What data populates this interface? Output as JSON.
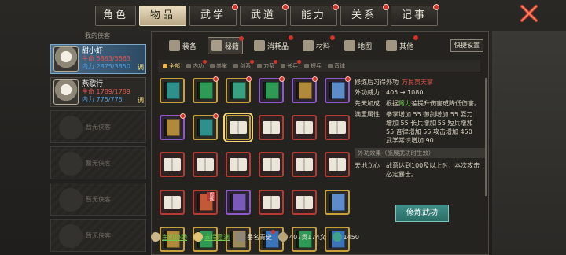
{
  "top_tabs": [
    {
      "label": "角色",
      "active": false,
      "dot": false
    },
    {
      "label": "物品",
      "active": true,
      "dot": false
    },
    {
      "label": "武学",
      "active": false,
      "dot": true
    },
    {
      "label": "武道",
      "active": false,
      "dot": true
    },
    {
      "label": "能力",
      "active": false,
      "dot": true
    },
    {
      "label": "关系",
      "active": false,
      "dot": true
    },
    {
      "label": "记事",
      "active": false,
      "dot": true
    }
  ],
  "roster": {
    "title": "我的侠客",
    "heroes": [
      {
        "name": "甜小虾",
        "hp": "生命 5863/5863",
        "mp": "内力 2875/3850",
        "tag": "调",
        "active": true
      },
      {
        "name": "燕歌行",
        "hp": "生命 1789/1789",
        "mp": "内力 775/775",
        "tag": "调",
        "active": false
      }
    ],
    "empty_label": "暂无侠客",
    "empty_count": 4
  },
  "categories": [
    {
      "label": "装备",
      "active": false,
      "icon": "helmet-icon",
      "dot": false
    },
    {
      "label": "秘籍",
      "active": true,
      "icon": "scroll-icon",
      "dot": true
    },
    {
      "label": "消耗品",
      "active": false,
      "icon": "flask-icon",
      "dot": true
    },
    {
      "label": "材料",
      "active": false,
      "icon": "ore-icon",
      "dot": true
    },
    {
      "label": "地图",
      "active": false,
      "icon": "map-icon",
      "dot": false
    },
    {
      "label": "其他",
      "active": false,
      "icon": "bag-icon",
      "dot": true
    }
  ],
  "quick_settings": "快捷设置",
  "filters": [
    {
      "label": "全部",
      "active": true,
      "dot": false
    },
    {
      "label": "内功",
      "active": false,
      "dot": true
    },
    {
      "label": "拳掌",
      "active": false,
      "dot": false
    },
    {
      "label": "剑系",
      "active": false,
      "dot": true
    },
    {
      "label": "刀系",
      "active": false,
      "dot": true
    },
    {
      "label": "长兵",
      "active": false,
      "dot": true
    },
    {
      "label": "短兵",
      "active": false,
      "dot": false
    },
    {
      "label": "音律",
      "active": false,
      "dot": false
    }
  ],
  "books": [
    {
      "frame": "yellow",
      "color": "#2f8f8a",
      "open": false,
      "dot": false
    },
    {
      "frame": "yellow",
      "color": "#2f9a53",
      "open": false,
      "dot": true
    },
    {
      "frame": "yellow",
      "color": "#3aa17e",
      "open": false,
      "dot": true
    },
    {
      "frame": "purple",
      "color": "#2f9a53",
      "open": false,
      "dot": true
    },
    {
      "frame": "purple",
      "color": "#b08a3a",
      "open": false,
      "dot": true
    },
    {
      "frame": "purple",
      "color": "#5e8cc8",
      "open": false,
      "dot": true
    },
    {
      "frame": "purple",
      "color": "#b08a3a",
      "open": false,
      "dot": true
    },
    {
      "frame": "yellow",
      "color": "#2f8f8a",
      "open": false,
      "dot": true
    },
    {
      "frame": "yellow",
      "color": "#e8e3d8",
      "open": true,
      "dot": false,
      "selected": true
    },
    {
      "frame": "red",
      "color": "#e8e3d8",
      "open": true,
      "dot": false
    },
    {
      "frame": "red",
      "color": "#e8e3d8",
      "open": true,
      "dot": false
    },
    {
      "frame": "red",
      "color": "#e8e3d8",
      "open": true,
      "dot": false
    },
    {
      "frame": "red",
      "color": "#e8e3d8",
      "open": true,
      "dot": false
    },
    {
      "frame": "red",
      "color": "#e8e3d8",
      "open": true,
      "dot": false
    },
    {
      "frame": "red",
      "color": "#e8e3d8",
      "open": true,
      "dot": false
    },
    {
      "frame": "red",
      "color": "#e8e3d8",
      "open": true,
      "dot": false
    },
    {
      "frame": "red",
      "color": "#e8e3d8",
      "open": true,
      "dot": false
    },
    {
      "frame": "red",
      "color": "#e8e3d8",
      "open": true,
      "dot": false
    },
    {
      "frame": "red",
      "color": "#e8e3d8",
      "open": true,
      "dot": false
    },
    {
      "frame": "red",
      "color": "#c25a3a",
      "open": false,
      "dot": false,
      "badge": "修炼"
    },
    {
      "frame": "purple",
      "color": "#7a5ab8",
      "open": false,
      "dot": false
    },
    {
      "frame": "red",
      "color": "#e8e3d8",
      "open": true,
      "dot": false
    },
    {
      "frame": "red",
      "color": "#e8e3d8",
      "open": true,
      "dot": false
    },
    {
      "frame": "yellow",
      "color": "#5e8cc8",
      "open": false,
      "dot": false
    },
    {
      "frame": "yellow",
      "color": "#b08a3a",
      "open": false,
      "dot": false
    },
    {
      "frame": "yellow",
      "color": "#2f9a53",
      "open": false,
      "dot": false
    },
    {
      "frame": "yellow",
      "color": "#9a8a5a",
      "open": false,
      "dot": false
    },
    {
      "frame": "yellow",
      "color": "#3a73b8",
      "open": false,
      "dot": false
    },
    {
      "frame": "yellow",
      "color": "#2f9a53",
      "open": false,
      "dot": false
    },
    {
      "frame": "yellow",
      "color": "#3a73b8",
      "open": false,
      "dot": false
    }
  ],
  "detail": {
    "learn_label": "修炼后习得外功",
    "learn_value": "万民贯天掌",
    "power_label": "外功威力",
    "power_value": "405 → 1080",
    "innate_label": "先天加成",
    "innate_pre": "根据",
    "innate_attr": "臂力",
    "innate_post": "差提升伤害或降低伤害。",
    "max_label": "满重属性",
    "max_lines": [
      "拳掌增加 55  御剑增加 55  耍刀",
      "增加 55  长兵增加 55  短兵增加",
      "55  音律增加 55  攻击增加 450",
      "武学常识增加 90"
    ],
    "effect_header": "外功效果（施展武功时生效）",
    "effect_label": "天地立心",
    "effect_text": "战意达到100及以上时，本次攻击必定暴击。",
    "train_button": "修炼武功"
  },
  "bottom_bar": {
    "main_label": "主机协助",
    "dots_label": "去得意满",
    "fame_label": "垂名青史",
    "money_label": "407贯174文",
    "gem_label": "1450"
  },
  "colors": {
    "accent_teal": "#2b6c66",
    "dot_red": "#d2342c"
  }
}
